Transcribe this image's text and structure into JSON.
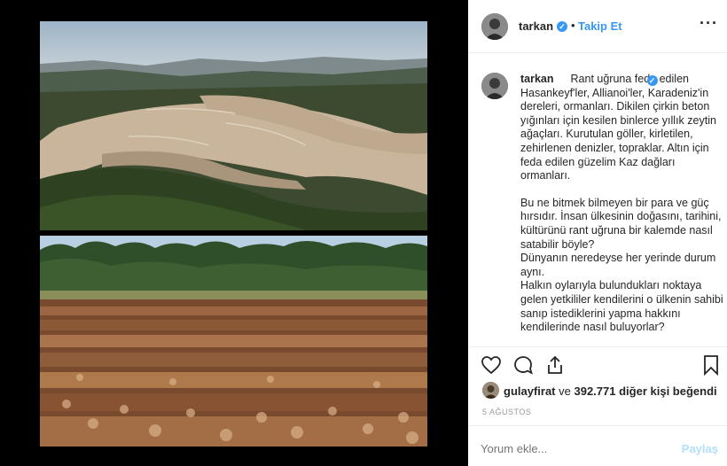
{
  "post": {
    "username": "tarkan",
    "follow_label": "Takip Et",
    "dot": "•",
    "more_icon": "more-horizontal-icon",
    "verified_icon": "verified-badge-icon"
  },
  "caption": {
    "username": "tarkan",
    "paragraph1": "Rant uğruna feda edilen Hasankeyf'ler, Allianoi'ler, Karadeniz'in dereleri, ormanları. Dikilen çirkin beton yığınları için kesilen binlerce yıllık zeytin ağaçları. Kurutulan göller, kirletilen, zehirlenen denizler, topraklar. Altın için feda edilen güzelim Kaz dağları ormanları.",
    "paragraph2": "Bu ne bitmek bilmeyen bir para ve güç hırsıdır. İnsan ülkesinin doğasını, tarihini, kültürünü rant uğruna bir kalemde nasıl satabilir böyle?\nDünyanın neredeyse her yerinde durum aynı.\nHalkın oylarıyla bulundukları noktaya gelen yetkililer kendilerini o ülkenin sahibi sanıp istediklerini yapma hakkını kendilerinde nasıl buluyorlar?"
  },
  "actions": {
    "like_icon": "heart-icon",
    "comment_icon": "comment-icon",
    "share_icon": "share-icon",
    "save_icon": "bookmark-icon"
  },
  "likes": {
    "user": "gulayfirat",
    "connector": " ve ",
    "count": "392.771",
    "suffix": " diğer kişi beğendi"
  },
  "date": "5 AĞUSTOS",
  "comment": {
    "placeholder": "Yorum ekle...",
    "post_label": "Paylaş"
  },
  "colors": {
    "accent": "#3897f0",
    "post_disabled": "#b2dffc",
    "muted": "#999999",
    "text": "#262626"
  }
}
